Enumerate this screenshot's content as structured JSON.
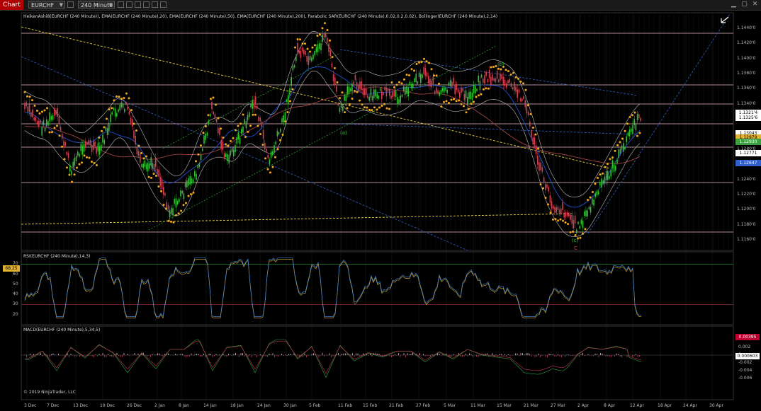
{
  "toolbar": {
    "chart_tab": "Chart",
    "instrument": "EURCHF",
    "interval": "240 Minute"
  },
  "panel1": {
    "label": "HeikenAshi8(EURCHF (240 Minute)), EMA(EURCHF (240 Minute),20), EMA(EURCHF (240 Minute),50), EMA(EURCHF (240 Minute),200), Parabolic SAR(EURCHF (240 Minute),0.02,0.2,0.02), Bollinger(EURCHF (240 Minute),2,14)",
    "price_ticks": [
      "1.1440'0",
      "1.1420'0",
      "1.1400'0",
      "1.1380'0",
      "1.1360'0",
      "1.1340'0",
      "1.1320'0",
      "1.1300'0",
      "1.1280'0",
      "1.1260'0",
      "1.1240'0",
      "1.1220'0",
      "1.1200'0",
      "1.1180'0",
      "1.1160'0"
    ],
    "price_badges": [
      {
        "text": "1.1321'4",
        "color": "#ffffff"
      },
      {
        "text": "1.1325'6",
        "color": "#ffffff"
      },
      {
        "text": "1.13043",
        "color": "#ffffff"
      },
      {
        "text": "1.12979",
        "color": "#e0b030"
      },
      {
        "text": "1.12930",
        "color": "#3aa040"
      },
      {
        "text": "1.12771",
        "color": "#ffffff"
      },
      {
        "text": "1.12647",
        "color": "#3060d0"
      }
    ],
    "wave_labels": [
      "(a)",
      "(b)",
      "(c)",
      "C"
    ]
  },
  "panel2": {
    "label": "RSI(EURCHF (240 Minute),14,3)",
    "value_badge": "68.25",
    "ticks": [
      "70",
      "60",
      "50",
      "40",
      "30",
      "20"
    ]
  },
  "panel3": {
    "label": "MACD(EURCHF (240 Minute),5,34,5)",
    "badges": [
      "0.00395",
      "0.000603"
    ],
    "ticks": [
      "0.002",
      "0",
      "-0.002",
      "-0.004",
      "-0.006"
    ]
  },
  "copyright": "© 2019 NinjaTrader, LLC",
  "x_labels": [
    "3 Dec",
    "7 Dec",
    "13 Dec",
    "19 Dec",
    "26 Dec",
    "2 Jan",
    "8 Jan",
    "14 Jan",
    "18 Jan",
    "24 Jan",
    "30 Jan",
    "5 Feb",
    "11 Feb",
    "15 Feb",
    "21 Feb",
    "27 Feb",
    "5 Mar",
    "11 Mar",
    "15 Mar",
    "21 Mar",
    "27 Mar",
    "2 Apr",
    "8 Apr",
    "12 Apr",
    "18 Apr",
    "24 Apr",
    "30 Apr"
  ],
  "icons": [
    "cursor-arrow-icon",
    "minimize-icon",
    "maximize-icon",
    "close-icon"
  ]
}
